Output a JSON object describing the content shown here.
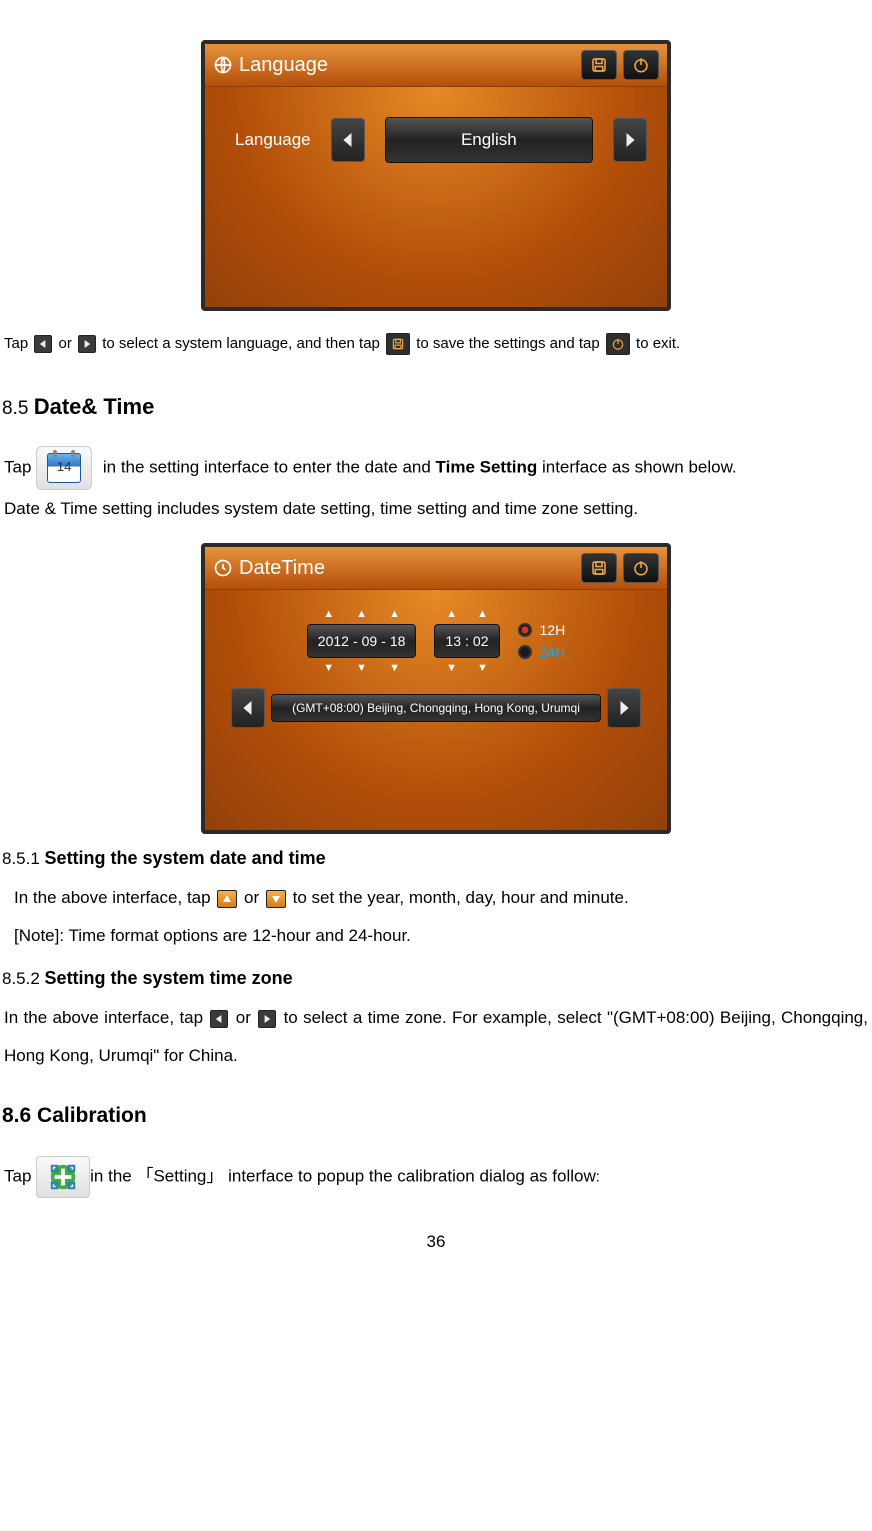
{
  "page_number": "36",
  "lang_panel": {
    "title": "Language",
    "label": "Language",
    "value": "English"
  },
  "dt_panel": {
    "title": "DateTime",
    "year": "2012",
    "month": "09",
    "day": "18",
    "hour": "13",
    "minute": "02",
    "mode12": "12H",
    "mode24": "24H",
    "timezone": "(GMT+08:00) Beijing, Chongqing, Hong Kong, Urumqi"
  },
  "body": {
    "p1a": "Tap ",
    "p1b": " or ",
    "p1c": " to select a system language, and then tap ",
    "p1d": " to save the settings and tap ",
    "p1e": " to exit.",
    "h85_a": "8.5 ",
    "h85_b": "Date& Time",
    "p2a": "Tap ",
    "cal_day": "14",
    "p2b": " in the setting interface to enter the date and ",
    "p2c": "Time Setting",
    "p2d": " interface as shown below.",
    "p3": "Date & Time setting includes system date setting, time setting and time zone setting.",
    "h851_a": "8.5.1 ",
    "h851_b": "Setting the system date and time",
    "p4a": "In the above interface, tap ",
    "p4b": " or ",
    "p4c": " to set the year, month, day, hour and minute.",
    "p5": "[Note]: Time format options are 12-hour and 24-hour.",
    "h852_a": "8.5.2 ",
    "h852_b": "Setting the system time zone",
    "p6a": "In  the  above  interface,  tap ",
    "p6b": " or ",
    "p6c": " to  select  a  time  zone.  For  example,  select \"(GMT+08:00) Beijing, Chongqing, Hong Kong, Urumqi\" for China.",
    "h86": "8.6 Calibration",
    "p7a": "Tap ",
    "p7b": "in the 「Setting」 interface to popup the calibration dialog as follow",
    "p7c": ":"
  }
}
